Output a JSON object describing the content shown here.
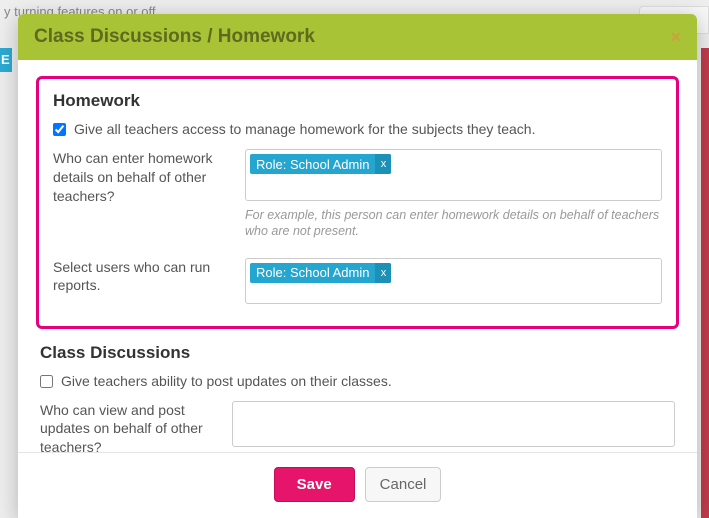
{
  "background": {
    "partial_text": "y turning features on or off.",
    "left_badge": "E"
  },
  "modal": {
    "title": "Class Discussions / Homework",
    "close": "×"
  },
  "homework": {
    "title": "Homework",
    "checkbox_label": "Give all teachers access to manage homework for the subjects they teach.",
    "checkbox_checked": true,
    "q1_label": "Who can enter homework details on behalf of other teachers?",
    "q1_tag": "Role: School Admin",
    "q1_tag_x": "x",
    "q1_helper": "For example, this person can enter homework details on behalf of teachers who are not present.",
    "q2_label": "Select users who can run reports.",
    "q2_tag": "Role: School Admin",
    "q2_tag_x": "x"
  },
  "discussions": {
    "title": "Class Discussions",
    "checkbox_label": "Give teachers ability to post updates on their classes.",
    "checkbox_checked": false,
    "q1_label": "Who can view and post updates on behalf of other teachers?"
  },
  "footer": {
    "save": "Save",
    "cancel": "Cancel"
  }
}
